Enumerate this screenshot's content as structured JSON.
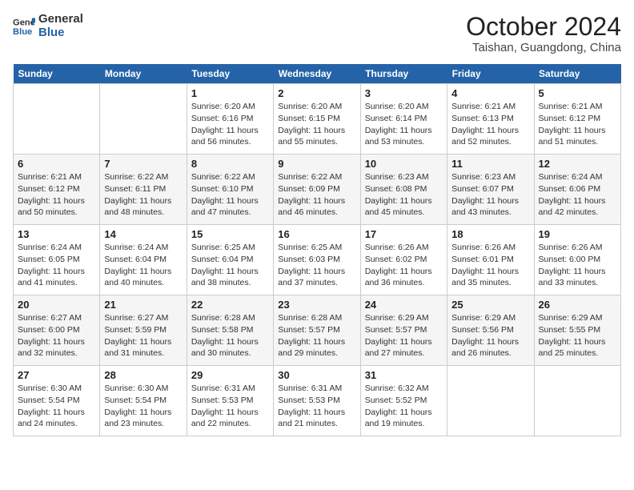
{
  "header": {
    "logo_general": "General",
    "logo_blue": "Blue",
    "month_title": "October 2024",
    "location": "Taishan, Guangdong, China"
  },
  "days_of_week": [
    "Sunday",
    "Monday",
    "Tuesday",
    "Wednesday",
    "Thursday",
    "Friday",
    "Saturday"
  ],
  "weeks": [
    [
      {
        "day": "",
        "info": ""
      },
      {
        "day": "",
        "info": ""
      },
      {
        "day": "1",
        "info": "Sunrise: 6:20 AM\nSunset: 6:16 PM\nDaylight: 11 hours and 56 minutes."
      },
      {
        "day": "2",
        "info": "Sunrise: 6:20 AM\nSunset: 6:15 PM\nDaylight: 11 hours and 55 minutes."
      },
      {
        "day": "3",
        "info": "Sunrise: 6:20 AM\nSunset: 6:14 PM\nDaylight: 11 hours and 53 minutes."
      },
      {
        "day": "4",
        "info": "Sunrise: 6:21 AM\nSunset: 6:13 PM\nDaylight: 11 hours and 52 minutes."
      },
      {
        "day": "5",
        "info": "Sunrise: 6:21 AM\nSunset: 6:12 PM\nDaylight: 11 hours and 51 minutes."
      }
    ],
    [
      {
        "day": "6",
        "info": "Sunrise: 6:21 AM\nSunset: 6:12 PM\nDaylight: 11 hours and 50 minutes."
      },
      {
        "day": "7",
        "info": "Sunrise: 6:22 AM\nSunset: 6:11 PM\nDaylight: 11 hours and 48 minutes."
      },
      {
        "day": "8",
        "info": "Sunrise: 6:22 AM\nSunset: 6:10 PM\nDaylight: 11 hours and 47 minutes."
      },
      {
        "day": "9",
        "info": "Sunrise: 6:22 AM\nSunset: 6:09 PM\nDaylight: 11 hours and 46 minutes."
      },
      {
        "day": "10",
        "info": "Sunrise: 6:23 AM\nSunset: 6:08 PM\nDaylight: 11 hours and 45 minutes."
      },
      {
        "day": "11",
        "info": "Sunrise: 6:23 AM\nSunset: 6:07 PM\nDaylight: 11 hours and 43 minutes."
      },
      {
        "day": "12",
        "info": "Sunrise: 6:24 AM\nSunset: 6:06 PM\nDaylight: 11 hours and 42 minutes."
      }
    ],
    [
      {
        "day": "13",
        "info": "Sunrise: 6:24 AM\nSunset: 6:05 PM\nDaylight: 11 hours and 41 minutes."
      },
      {
        "day": "14",
        "info": "Sunrise: 6:24 AM\nSunset: 6:04 PM\nDaylight: 11 hours and 40 minutes."
      },
      {
        "day": "15",
        "info": "Sunrise: 6:25 AM\nSunset: 6:04 PM\nDaylight: 11 hours and 38 minutes."
      },
      {
        "day": "16",
        "info": "Sunrise: 6:25 AM\nSunset: 6:03 PM\nDaylight: 11 hours and 37 minutes."
      },
      {
        "day": "17",
        "info": "Sunrise: 6:26 AM\nSunset: 6:02 PM\nDaylight: 11 hours and 36 minutes."
      },
      {
        "day": "18",
        "info": "Sunrise: 6:26 AM\nSunset: 6:01 PM\nDaylight: 11 hours and 35 minutes."
      },
      {
        "day": "19",
        "info": "Sunrise: 6:26 AM\nSunset: 6:00 PM\nDaylight: 11 hours and 33 minutes."
      }
    ],
    [
      {
        "day": "20",
        "info": "Sunrise: 6:27 AM\nSunset: 6:00 PM\nDaylight: 11 hours and 32 minutes."
      },
      {
        "day": "21",
        "info": "Sunrise: 6:27 AM\nSunset: 5:59 PM\nDaylight: 11 hours and 31 minutes."
      },
      {
        "day": "22",
        "info": "Sunrise: 6:28 AM\nSunset: 5:58 PM\nDaylight: 11 hours and 30 minutes."
      },
      {
        "day": "23",
        "info": "Sunrise: 6:28 AM\nSunset: 5:57 PM\nDaylight: 11 hours and 29 minutes."
      },
      {
        "day": "24",
        "info": "Sunrise: 6:29 AM\nSunset: 5:57 PM\nDaylight: 11 hours and 27 minutes."
      },
      {
        "day": "25",
        "info": "Sunrise: 6:29 AM\nSunset: 5:56 PM\nDaylight: 11 hours and 26 minutes."
      },
      {
        "day": "26",
        "info": "Sunrise: 6:29 AM\nSunset: 5:55 PM\nDaylight: 11 hours and 25 minutes."
      }
    ],
    [
      {
        "day": "27",
        "info": "Sunrise: 6:30 AM\nSunset: 5:54 PM\nDaylight: 11 hours and 24 minutes."
      },
      {
        "day": "28",
        "info": "Sunrise: 6:30 AM\nSunset: 5:54 PM\nDaylight: 11 hours and 23 minutes."
      },
      {
        "day": "29",
        "info": "Sunrise: 6:31 AM\nSunset: 5:53 PM\nDaylight: 11 hours and 22 minutes."
      },
      {
        "day": "30",
        "info": "Sunrise: 6:31 AM\nSunset: 5:53 PM\nDaylight: 11 hours and 21 minutes."
      },
      {
        "day": "31",
        "info": "Sunrise: 6:32 AM\nSunset: 5:52 PM\nDaylight: 11 hours and 19 minutes."
      },
      {
        "day": "",
        "info": ""
      },
      {
        "day": "",
        "info": ""
      }
    ]
  ]
}
